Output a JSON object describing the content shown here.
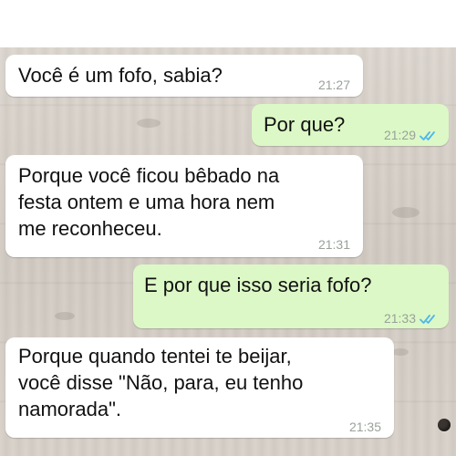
{
  "messages": [
    {
      "text": "Você é um fofo, sabia?",
      "time": "21:27",
      "direction": "incoming"
    },
    {
      "text": "Por que?",
      "time": "21:29",
      "direction": "outgoing",
      "read": true
    },
    {
      "lines": [
        "Porque você ficou bêbado na",
        "festa ontem e uma hora nem",
        "me reconheceu."
      ],
      "time": "21:31",
      "direction": "incoming"
    },
    {
      "text": "E por que isso seria fofo?",
      "time": "21:33",
      "direction": "outgoing",
      "read": true
    },
    {
      "lines": [
        "Porque quando tentei te beijar,",
        "você disse \"Não, para, eu tenho",
        "namorada\"."
      ],
      "time": "21:35",
      "direction": "incoming"
    }
  ],
  "colors": {
    "incoming_bubble": "#ffffff",
    "outgoing_bubble": "#dcf8c6",
    "read_check": "#4fb6ec",
    "timestamp": "#9aa19a"
  },
  "icons": {
    "read_receipt": "double-check-icon"
  }
}
